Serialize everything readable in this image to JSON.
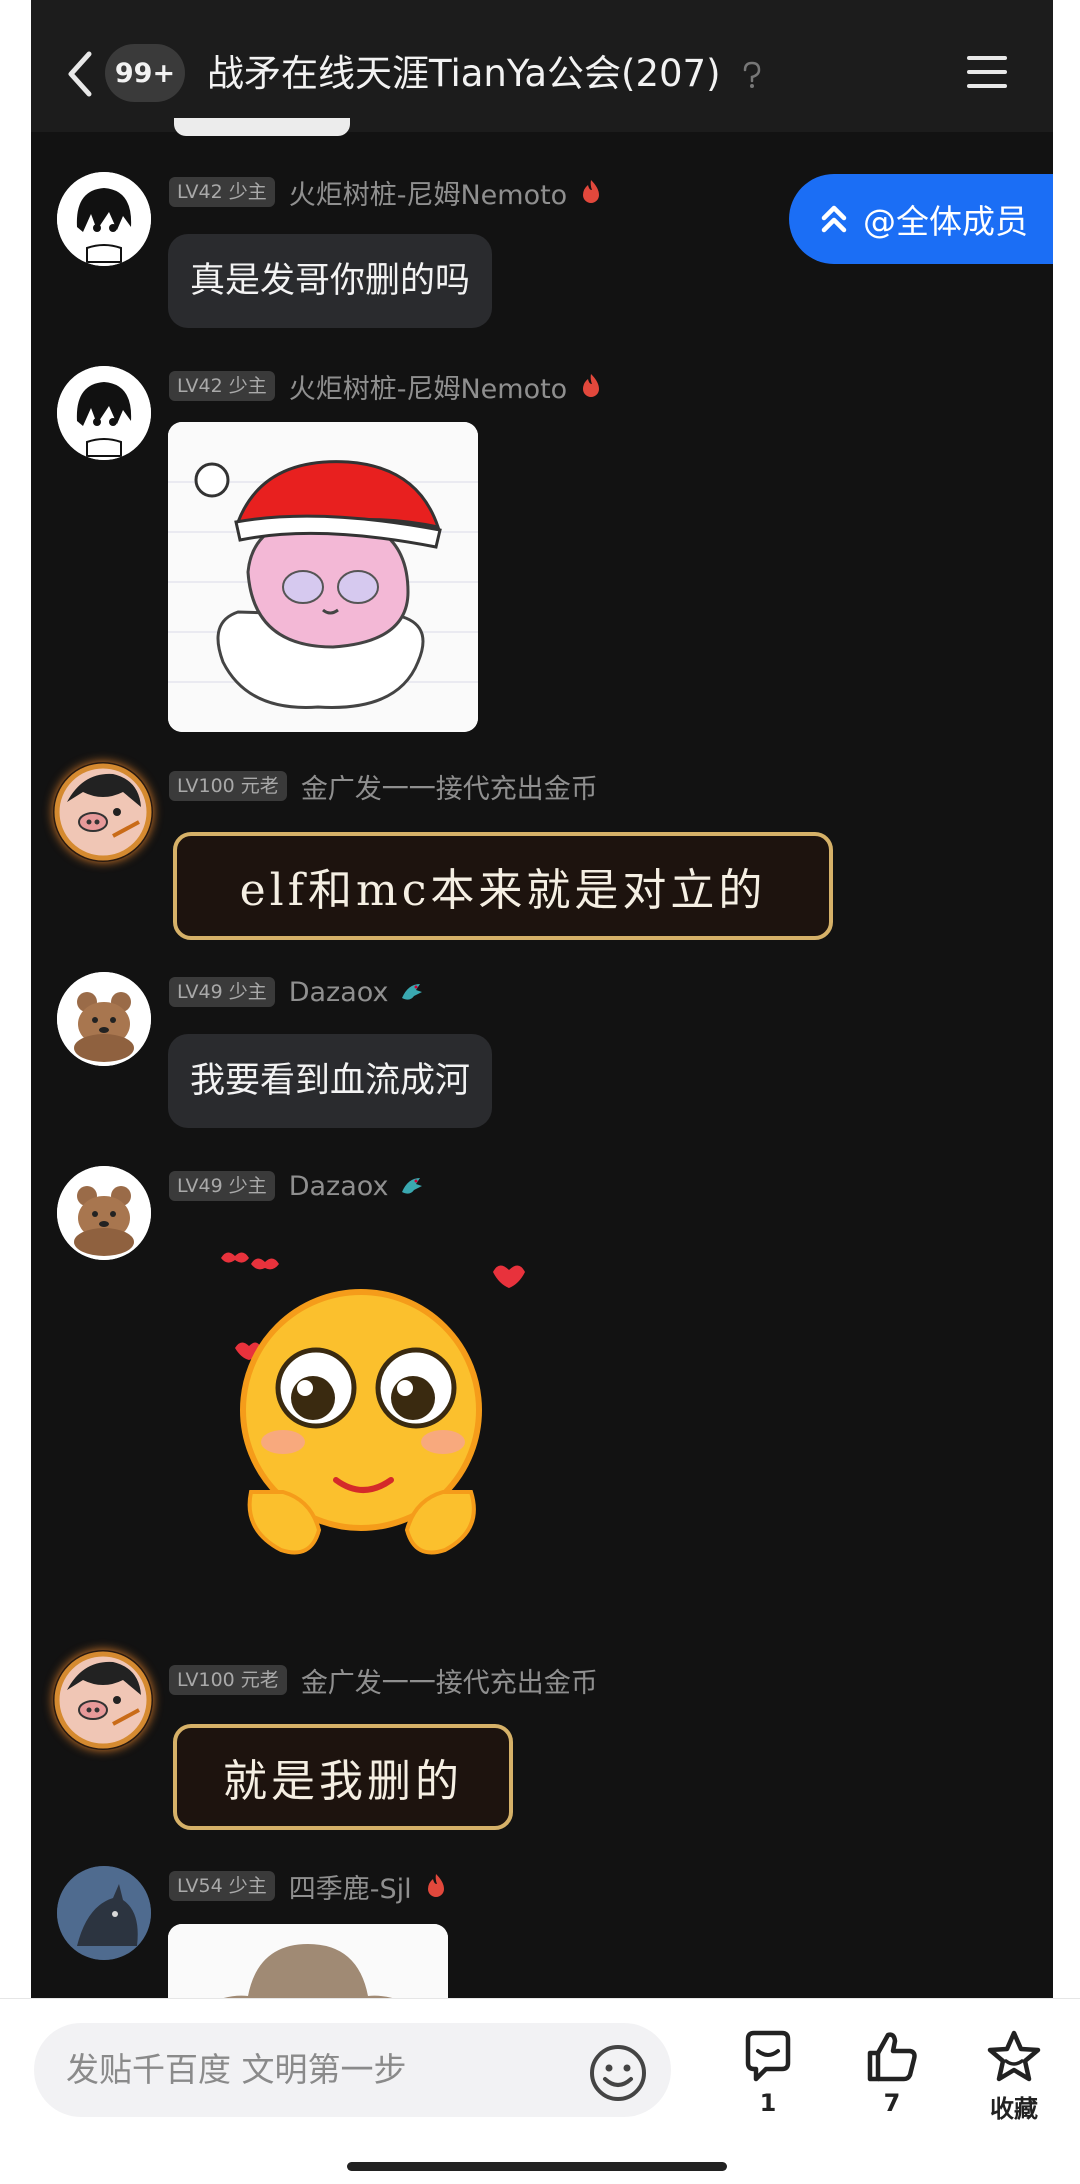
{
  "header": {
    "back_label": "back",
    "unread_badge": "99+",
    "title": "战矛在线天涯TianYa公会(207)",
    "help_icon": "help-icon",
    "menu_icon": "menu-icon"
  },
  "at_all_button": {
    "label": "@全体成员",
    "icon": "double-chevron-up-icon"
  },
  "messages": [
    {
      "level": "LV42 少主",
      "name": "火炬树桩-尼姆Nemoto",
      "badge": "fire-icon",
      "text": "真是发哥你删的吗"
    },
    {
      "level": "LV42 少主",
      "name": "火炬树桩-尼姆Nemoto",
      "badge": "fire-icon",
      "sticker": "santa-hat-anime-girl-sticker"
    },
    {
      "level": "LV100 元老",
      "name": "金广发一一接代充出金币",
      "text": "elf和mc本来就是对立的"
    },
    {
      "level": "LV49 少主",
      "name": "Dazaox",
      "badge": "dragon-icon",
      "text": "我要看到血流成河"
    },
    {
      "level": "LV49 少主",
      "name": "Dazaox",
      "badge": "dragon-icon",
      "sticker": "pleading-emoji-hearts-sticker"
    },
    {
      "level": "LV100 元老",
      "name": "金广发一一接代充出金币",
      "text": "就是我删的"
    },
    {
      "level": "LV54 少主",
      "name": "四季鹿-Sjl",
      "badge": "fire-icon",
      "sticker": "cowboy-hat-sticker"
    }
  ],
  "bottom_bar": {
    "input_placeholder": "发贴千百度 文明第一步",
    "comment_count": "1",
    "like_count": "7",
    "favorite_label": "收藏"
  },
  "colors": {
    "chat_bg": "#121212",
    "bubble_bg": "#2a2b2e",
    "accent_blue": "#1b6ef5",
    "fancy_border": "#d6b168"
  }
}
